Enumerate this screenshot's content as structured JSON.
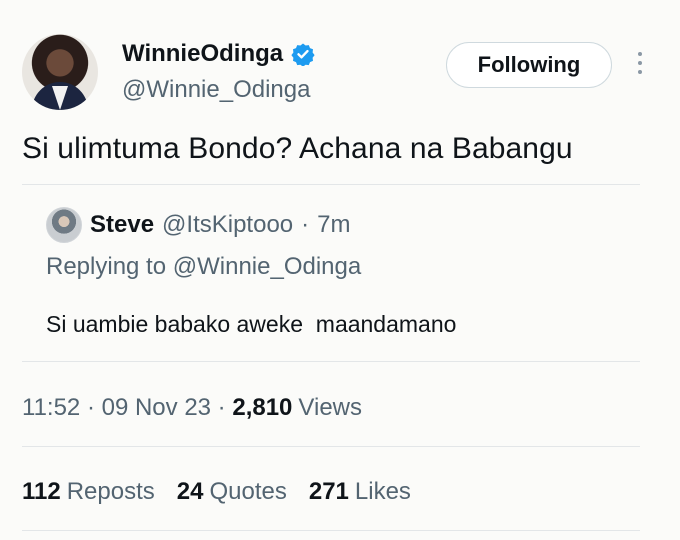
{
  "author": {
    "display_name": "WinnieOdinga",
    "handle": "@Winnie_Odinga",
    "verified": true,
    "follow_label": "Following"
  },
  "tweet": {
    "text": "Si ulimtuma Bondo? Achana na Babangu"
  },
  "quoted": {
    "name": "Steve",
    "handle": "@ItsKiptooo",
    "sep": "·",
    "time": "7m",
    "replying_prefix": "Replying to",
    "replying_to": "@Winnie_Odinga",
    "text": "Si uambie babako aweke  maandamano"
  },
  "meta": {
    "time": "11:52",
    "date": "09 Nov 23",
    "sep": " · ",
    "views_count": "2,810",
    "views_label": "Views"
  },
  "stats": {
    "reposts_count": "112",
    "reposts_label": "Reposts",
    "quotes_count": "24",
    "quotes_label": "Quotes",
    "likes_count": "271",
    "likes_label": "Likes"
  },
  "colors": {
    "verified_blue": "#1d9bf0",
    "secondary_text": "#536471",
    "primary_text": "#0f1419"
  },
  "icons": {
    "verified": "verified-badge-icon",
    "more": "more-vertical-icon"
  }
}
